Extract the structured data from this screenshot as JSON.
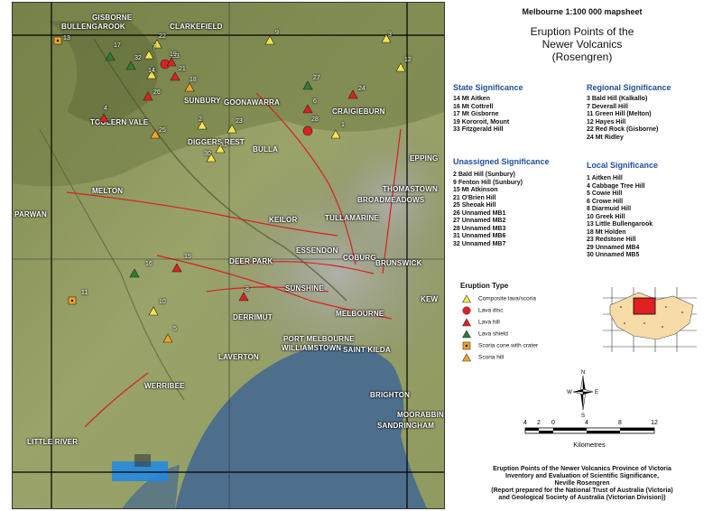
{
  "sheet_title": "Melbourne 1:100 000 mapsheet",
  "title_lines": [
    "Eruption Points of the",
    "Newer Volcanics",
    "(Rosengren)"
  ],
  "significance": {
    "state": {
      "heading": "State Significance",
      "items": [
        "14  Mt Aitken",
        "16  Mt Cottrell",
        "17  Mt Gisborne",
        "19  Kororoit, Mount",
        "33  Fitzgerald Hill"
      ]
    },
    "regional": {
      "heading": "Regional Significance",
      "items": [
        "3  Bald Hill (Kalkallo)",
        "7  Deverall Hill",
        "11  Green Hill (Melton)",
        "12  Hayes Hill",
        "22  Red Rock (Gisborne)",
        "24  Mt Ridley"
      ]
    },
    "unassigned": {
      "heading": "Unassigned Significance",
      "items": [
        "2  Bald Hill (Sunbury)",
        "9  Fenton Hill (Sunbury)",
        "15  Mt Atkinson",
        "21  O'Brien Hill",
        "25  Sheoak Hill",
        "26  Unnamed MB1",
        "27  Unnamed MB2",
        "28  Unnamed MB3",
        "31  Unnamed MB6",
        "32  Unnamed MB7"
      ]
    },
    "local": {
      "heading": "Local Significance",
      "items": [
        "1  Aitken Hill",
        "4  Cabbage Tree Hill",
        "5  Cowie Hill",
        "6  Crowe Hill",
        "8  Diarmuid Hill",
        "10  Greek Hill",
        "13  Little Bullengarook",
        "18  Mt Holden",
        "23  Redstone Hill",
        "29  Unnamed MB4",
        "30  Unnamed MB5"
      ]
    }
  },
  "legend": {
    "title": "Eruption Type",
    "items": [
      {
        "label": "Composite lava/scoria",
        "symbol": "triangle",
        "color": "#f2e64a"
      },
      {
        "label": "Lava disc",
        "symbol": "circle",
        "color": "#e02020"
      },
      {
        "label": "Lava hill",
        "symbol": "triangle",
        "color": "#e02020"
      },
      {
        "label": "Lava shield",
        "symbol": "triangle",
        "color": "#2e7d32"
      },
      {
        "label": "Scoria cone with crater",
        "symbol": "square-dot",
        "color": "#f5a623"
      },
      {
        "label": "Scoria hill",
        "symbol": "triangle",
        "color": "#f5a623"
      }
    ]
  },
  "compass": {
    "n": "N",
    "s": "S",
    "e": "E",
    "w": "W"
  },
  "scale": {
    "ticks": [
      "4",
      "2",
      "0",
      "4",
      "8",
      "12"
    ],
    "unit": "Kilometres"
  },
  "credit_lines": [
    "Eruption Points of the Newer Volcanics Province of Victoria",
    "Inventory and Evaluation of Scientific Significance,",
    "Neville Rosengren",
    "(Report prepared for the National Trust of Australia (Victoria)",
    "and Geological Society of Australia (Victorian Division))"
  ],
  "places": [
    "GISBORNE",
    "BULLENGAROOK",
    "CLARKEFIELD",
    "SUNBURY",
    "GOONAWARRA",
    "CRAIGIEBURN",
    "TOOLERN VALE",
    "DIGGERS REST",
    "BULLA",
    "EPPING",
    "THOMASTOWN",
    "MELTON",
    "BROADMEADOWS",
    "PARWAN",
    "KEILOR",
    "TULLAMARINE",
    "ESSENDON",
    "COBURG",
    "BRUNSWICK",
    "DEER PARK",
    "SUNSHINE",
    "KEW",
    "DERRIMUT",
    "MELBOURNE",
    "PORT MELBOURNE",
    "WILLIAMSTOWN",
    "SAINT KILDA",
    "LAVERTON",
    "WERRIBEE",
    "BRIGHTON",
    "MOORABBIN",
    "SANDRINGHAM",
    "LITTLE RIVER"
  ],
  "eruption_numbers": [
    "13",
    "17",
    "32",
    "7",
    "22",
    "33",
    "14",
    "21",
    "19",
    "26",
    "4",
    "18",
    "2",
    "25",
    "31",
    "30",
    "23",
    "9",
    "3",
    "12",
    "27",
    "24",
    "6",
    "28",
    "1",
    "15",
    "16",
    "11",
    "10",
    "8",
    "5"
  ],
  "colors": {
    "water": "#4d6f8c",
    "land": "#8c9a63",
    "urban": "#9a9a9a",
    "road": "#d62020",
    "grid": "#000000"
  }
}
